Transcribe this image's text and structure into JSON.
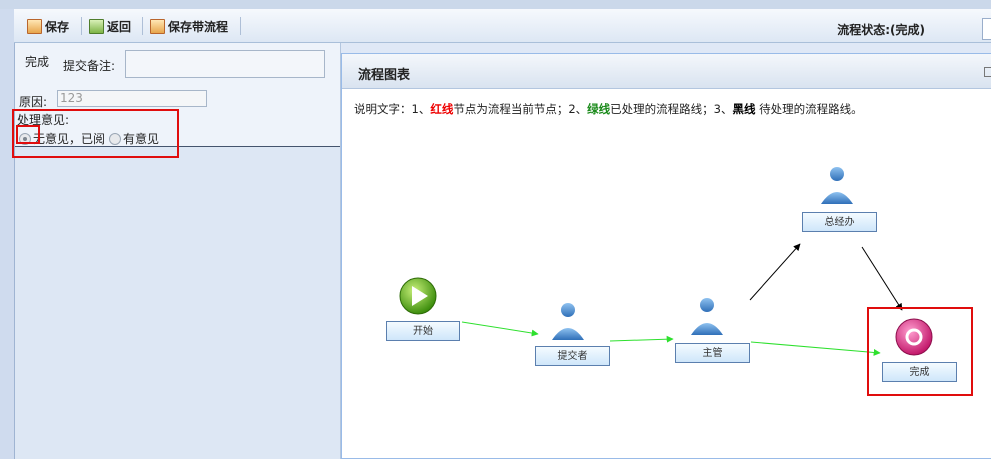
{
  "toolbar": {
    "save_label": "保存",
    "back_label": "返回",
    "save_flow_label": "保存带流程",
    "status_text": "流程状态:(完成)"
  },
  "form": {
    "status_value": "完成",
    "remark_label": "提交备注:",
    "remark_value": "",
    "reason_label": "原因:",
    "reason_value": "123",
    "opinion_label": "处理意见:",
    "opinion_options": [
      {
        "label": "无意见，已阅",
        "selected": true
      },
      {
        "label": "有意见",
        "selected": false
      }
    ]
  },
  "panel": {
    "title": "流程图表",
    "desc_prefix": "说明文字：1、",
    "desc_red": "红线",
    "desc_mid1": "节点为流程当前节点；2、",
    "desc_green": "绿线",
    "desc_mid2": "已处理的流程路线；3、",
    "desc_black": "黑线",
    "desc_suffix": " 待处理的流程路线。"
  },
  "flow": {
    "nodes": {
      "start": "开始",
      "submitter": "提交者",
      "supervisor": "主管",
      "gm_office": "总经办",
      "done": "完成"
    },
    "colors": {
      "processed": "#2ee02e",
      "pending": "#000000",
      "current": "#e00d0d"
    }
  }
}
